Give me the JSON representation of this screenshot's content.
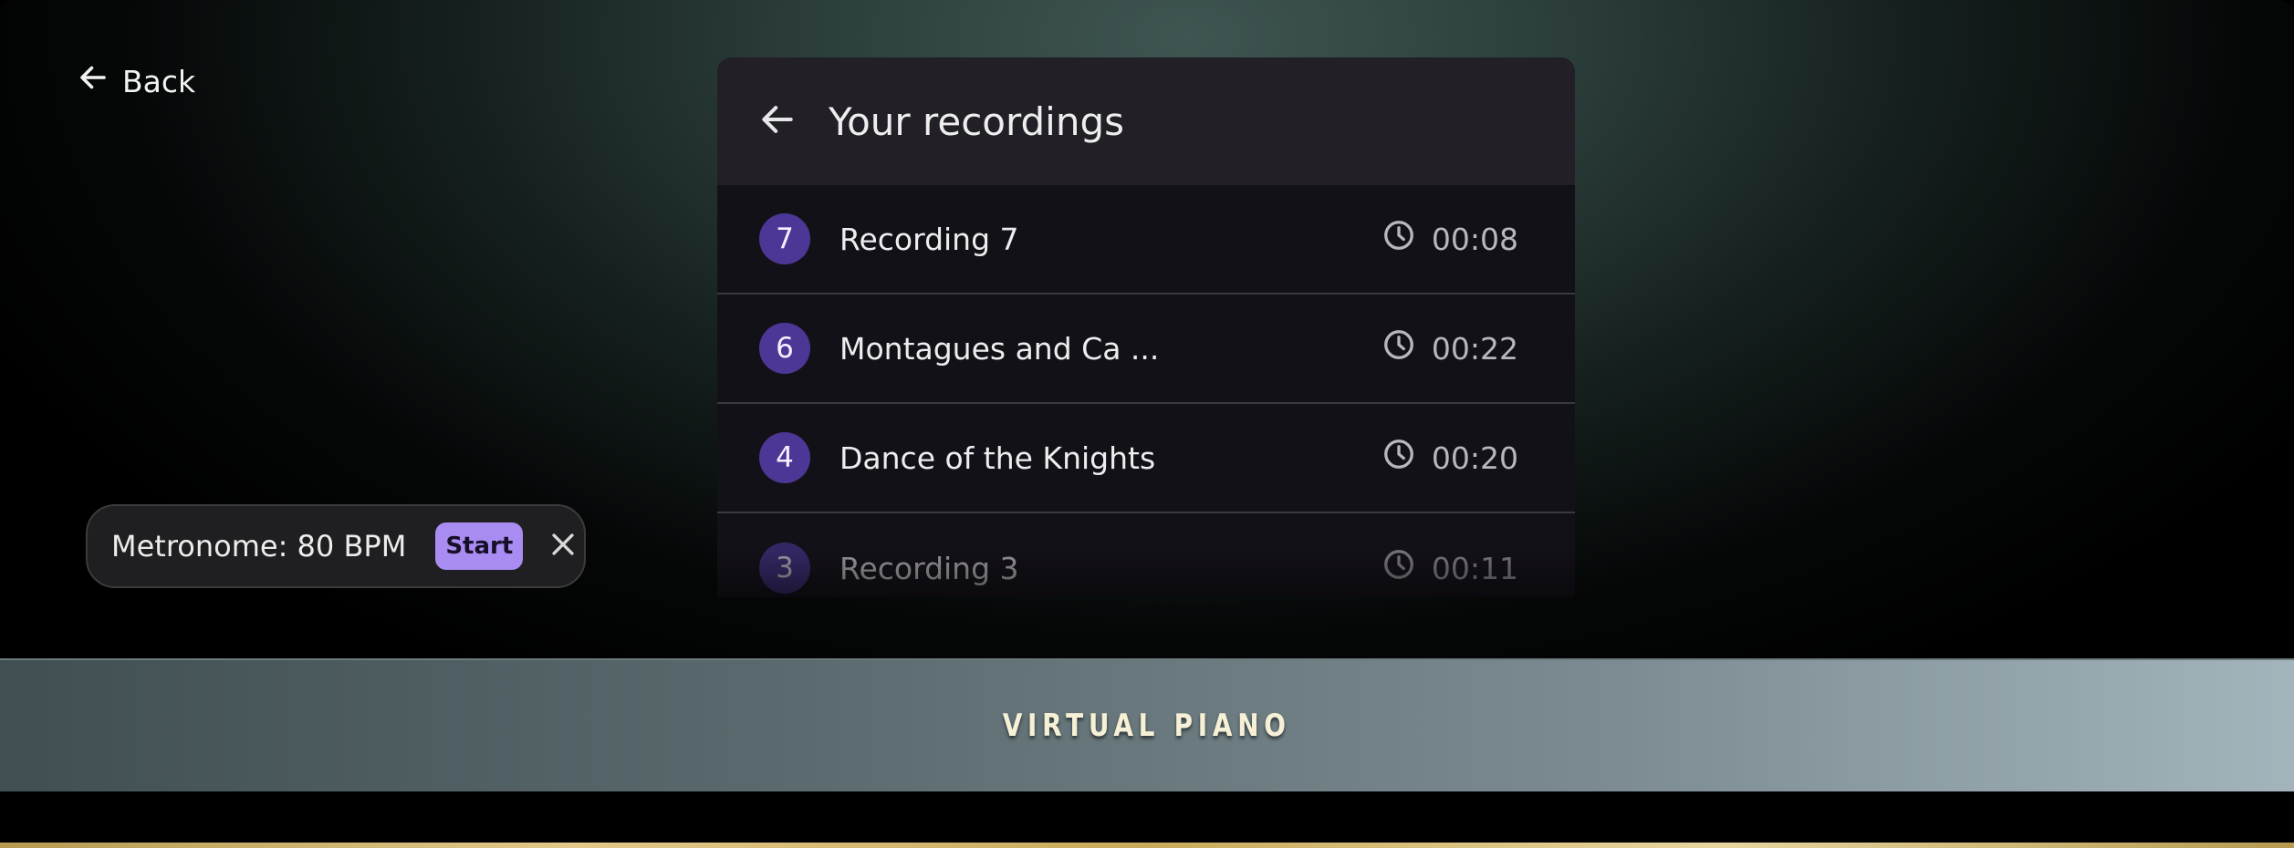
{
  "nav": {
    "back_label": "Back"
  },
  "recordings_panel": {
    "title": "Your recordings",
    "items": [
      {
        "number": "7",
        "name": "Recording 7",
        "duration": "00:08"
      },
      {
        "number": "6",
        "name": "Montagues and Ca  ...",
        "duration": "00:22"
      },
      {
        "number": "4",
        "name": "Dance of the Knights",
        "duration": "00:20"
      },
      {
        "number": "3",
        "name": "Recording 3",
        "duration": "00:11"
      }
    ]
  },
  "metronome": {
    "label": "Metronome: 80 BPM",
    "start_label": "Start"
  },
  "brand": {
    "title": "VIRTUAL PIANO"
  },
  "colors": {
    "accent": "#a98cf2",
    "badge": "#4d3796",
    "panel_header": "#221f26",
    "panel_body": "#131118"
  },
  "icons": {
    "back": "arrow-left-icon",
    "duration": "clock-icon",
    "close": "close-icon"
  }
}
